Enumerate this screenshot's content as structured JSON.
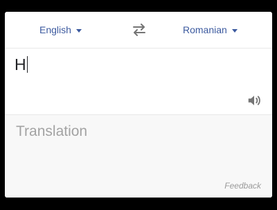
{
  "languages": {
    "source": "English",
    "target": "Romanian"
  },
  "input": {
    "text": "H"
  },
  "output": {
    "placeholder": "Translation"
  },
  "footer": {
    "feedback_label": "Feedback"
  },
  "icons": {
    "swap": "swap-arrows-icon",
    "speaker": "speaker-icon",
    "dropdown": "caret-down-icon"
  },
  "colors": {
    "accent": "#3c5a9f",
    "placeholder": "#a3a3a3",
    "icon": "#757575"
  }
}
